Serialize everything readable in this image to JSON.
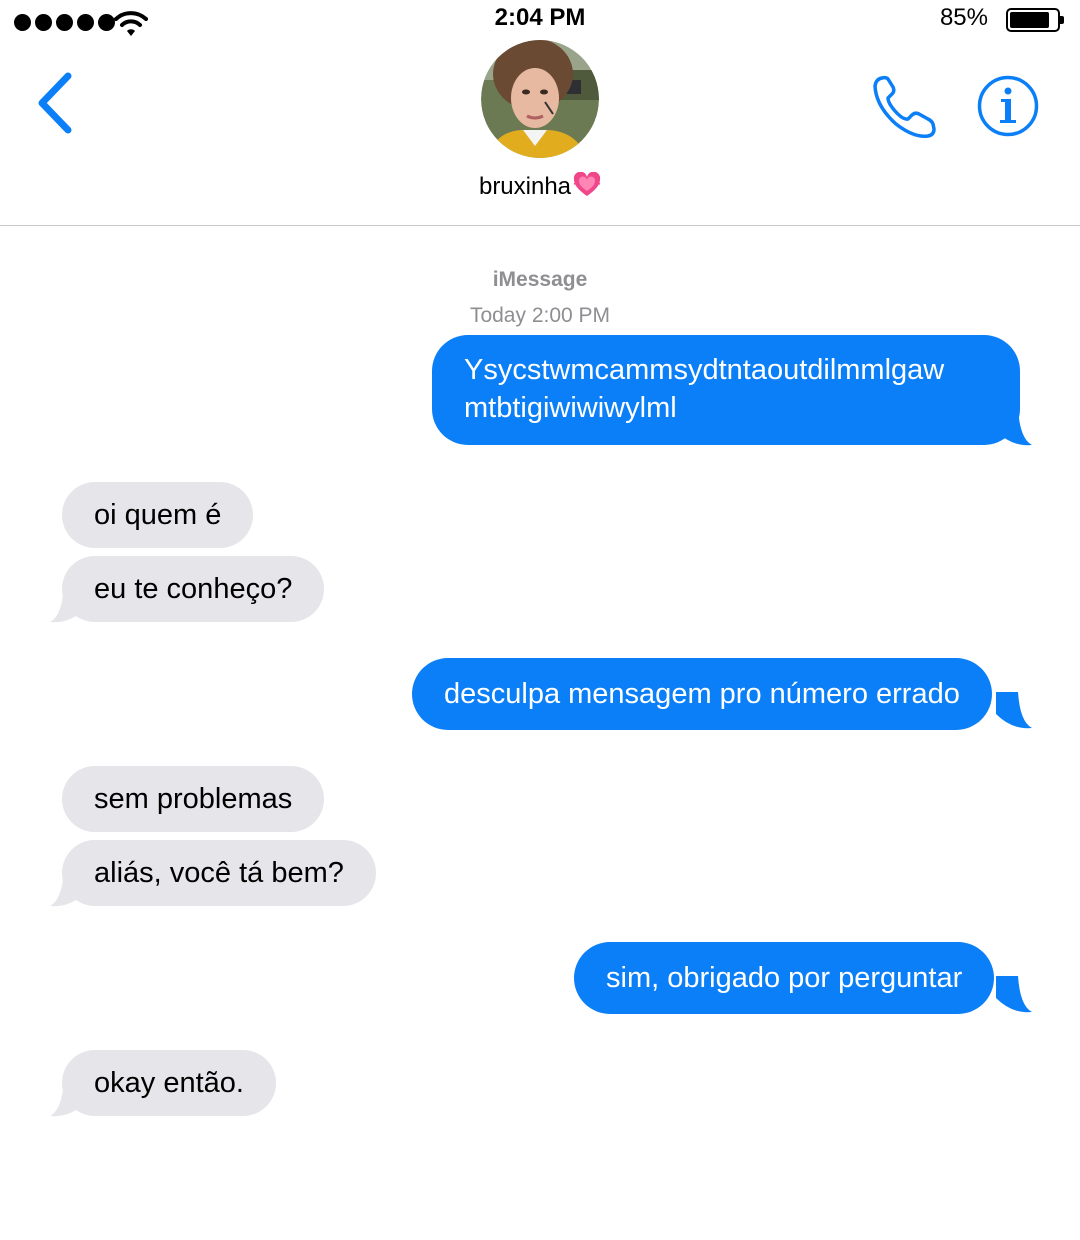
{
  "status_bar": {
    "time": "2:04 PM",
    "battery_percent": "85%",
    "battery_level": 0.85,
    "signal_bars": 5
  },
  "header": {
    "contact_name": "bruxinha",
    "contact_emoji": "💓",
    "back_icon": "chevron-left-icon",
    "call_icon": "phone-icon",
    "info_icon": "info-icon"
  },
  "conversation": {
    "service": "iMessage",
    "timestamp": "Today 2:00 PM",
    "messages": [
      {
        "direction": "outgoing",
        "text_lines": [
          "Ysycstwmcammsydtntaoutdilmmlgaw",
          "mtbtigiwiwiwylml"
        ]
      },
      {
        "direction": "incoming",
        "text": "oi quem é"
      },
      {
        "direction": "incoming",
        "text": "eu te conheço?"
      },
      {
        "direction": "outgoing",
        "text": "desculpa mensagem pro número errado"
      },
      {
        "direction": "incoming",
        "text": "sem problemas"
      },
      {
        "direction": "incoming",
        "text": "aliás, você tá bem?"
      },
      {
        "direction": "outgoing",
        "text": "sim, obrigado por perguntar"
      },
      {
        "direction": "incoming",
        "text": "okay então."
      }
    ]
  },
  "colors": {
    "outgoing_bubble": "#0b7ff7",
    "incoming_bubble": "#e5e5ea",
    "accent": "#0b7ff7",
    "meta_text": "#8e8e93"
  }
}
